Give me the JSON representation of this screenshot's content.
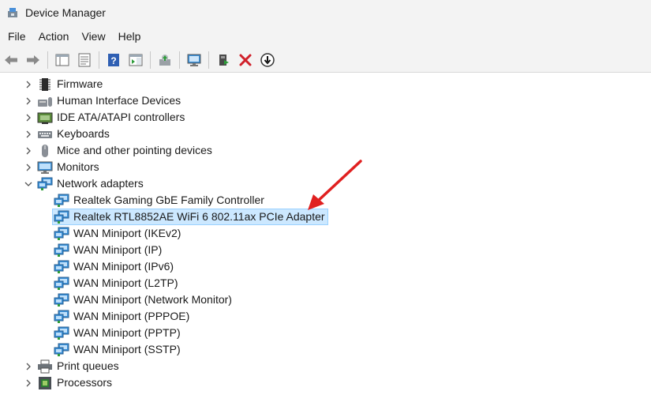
{
  "window": {
    "title": "Device Manager"
  },
  "menu": {
    "items": [
      "File",
      "Action",
      "View",
      "Help"
    ]
  },
  "toolbar": {
    "icons": [
      "back-icon",
      "forward-icon",
      "show-hide-tree-icon",
      "properties-icon",
      "help-icon",
      "action-pane-icon",
      "update-driver-icon",
      "scan-hardware-icon",
      "enable-device-icon",
      "uninstall-icon",
      "disable-device-icon"
    ]
  },
  "tree": {
    "categories_before": [
      {
        "label": "Firmware",
        "icon": "chip-icon"
      },
      {
        "label": "Human Interface Devices",
        "icon": "hid-icon"
      },
      {
        "label": "IDE ATA/ATAPI controllers",
        "icon": "ide-icon"
      },
      {
        "label": "Keyboards",
        "icon": "keyboard-icon"
      },
      {
        "label": "Mice and other pointing devices",
        "icon": "mouse-icon"
      },
      {
        "label": "Monitors",
        "icon": "monitor-icon"
      }
    ],
    "expanded": {
      "label": "Network adapters",
      "icon": "network-adapter-icon",
      "children": [
        "Realtek Gaming GbE Family Controller",
        "Realtek RTL8852AE WiFi 6 802.11ax PCIe Adapter",
        "WAN Miniport (IKEv2)",
        "WAN Miniport (IP)",
        "WAN Miniport (IPv6)",
        "WAN Miniport (L2TP)",
        "WAN Miniport (Network Monitor)",
        "WAN Miniport (PPPOE)",
        "WAN Miniport (PPTP)",
        "WAN Miniport (SSTP)"
      ],
      "selected_index": 1
    },
    "categories_after": [
      {
        "label": "Print queues",
        "icon": "printer-icon"
      },
      {
        "label": "Processors",
        "icon": "processor-icon"
      }
    ]
  },
  "colors": {
    "selection_bg": "#cce8ff",
    "selection_border": "#99d1ff",
    "arrow": "#e02020"
  }
}
